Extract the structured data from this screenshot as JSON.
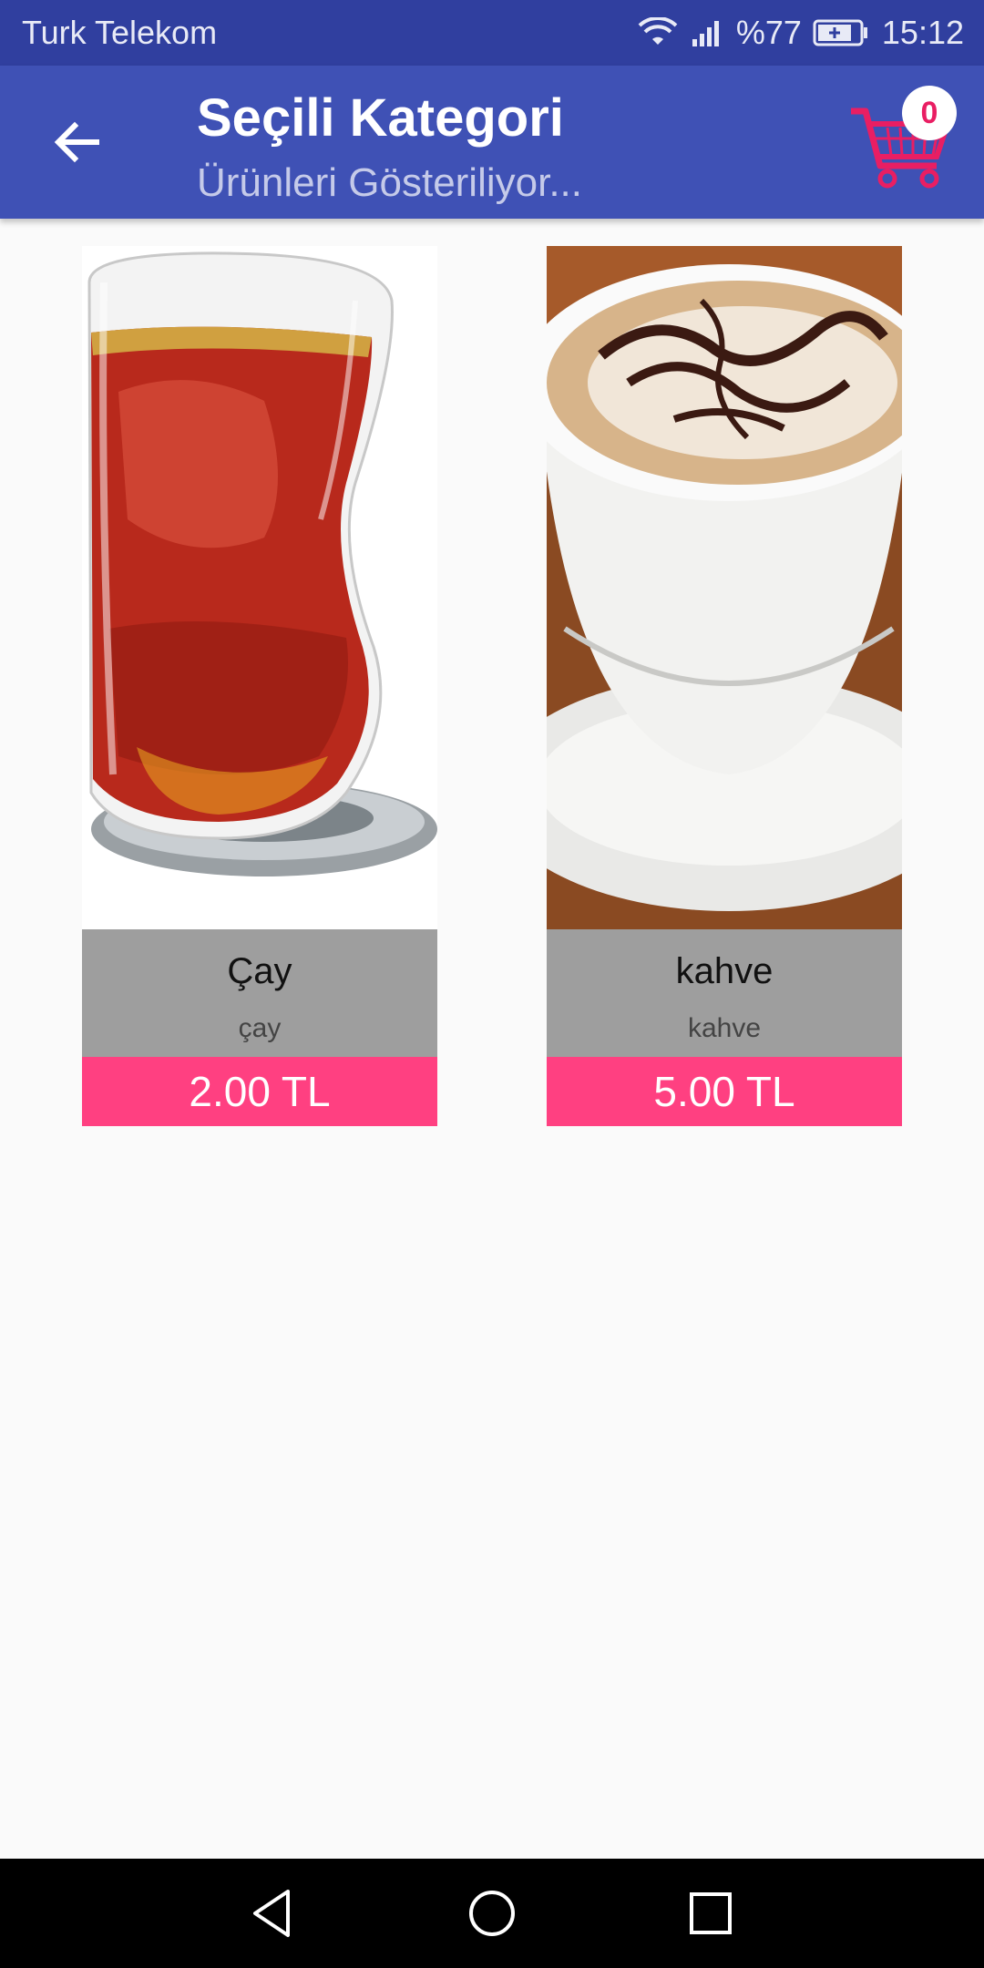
{
  "status_bar": {
    "carrier": "Turk Telekom",
    "battery": "%77",
    "time": "15:12",
    "icons": [
      "wifi-icon",
      "signal-icon",
      "battery-charging-icon"
    ]
  },
  "app_bar": {
    "title": "Seçili Kategori",
    "subtitle": "Ürünleri Gösteriliyor...",
    "back_icon": "arrow-back-icon",
    "cart_icon": "shopping-cart-icon",
    "cart_count": "0"
  },
  "products": [
    {
      "image": "tea-glass-image",
      "name": "Çay",
      "description": "çay",
      "price": "2.00 TL"
    },
    {
      "image": "coffee-cup-image",
      "name": "kahve",
      "description": "kahve",
      "price": "5.00 TL"
    }
  ],
  "nav_bar": {
    "icons": [
      "nav-back-icon",
      "nav-home-icon",
      "nav-recents-icon"
    ]
  },
  "colors": {
    "status_bar": "#303f9f",
    "app_bar": "#3f51b5",
    "price_bar": "#ff4081",
    "info_bar": "#9e9e9e",
    "cart": "#e91e63"
  }
}
